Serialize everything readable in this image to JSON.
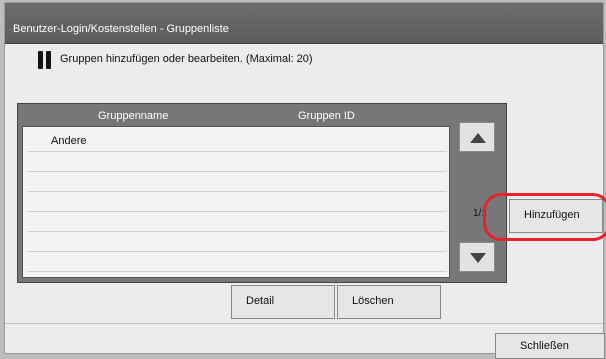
{
  "window": {
    "title": "Benutzer-Login/Kostenstellen - Gruppenliste"
  },
  "instruction": "Gruppen hinzufügen oder bearbeiten. (Maximal: 20)",
  "table": {
    "headers": [
      "Gruppenname",
      "Gruppen ID"
    ],
    "rows": [
      {
        "name": "Andere",
        "id": ""
      },
      {
        "name": "",
        "id": ""
      },
      {
        "name": "",
        "id": ""
      },
      {
        "name": "",
        "id": ""
      },
      {
        "name": "",
        "id": ""
      },
      {
        "name": "",
        "id": ""
      },
      {
        "name": "",
        "id": ""
      }
    ]
  },
  "pagination": {
    "label": "1/1"
  },
  "buttons": {
    "add": "Hinzufügen",
    "detail": "Detail",
    "delete": "Löschen",
    "close": "Schließen"
  },
  "colors": {
    "highlight": "#e8212a",
    "titlebar": "#5c5c5c"
  },
  "icons": {
    "info": "info-icon",
    "scroll_up": "arrow-up-icon",
    "scroll_down": "arrow-down-icon"
  }
}
